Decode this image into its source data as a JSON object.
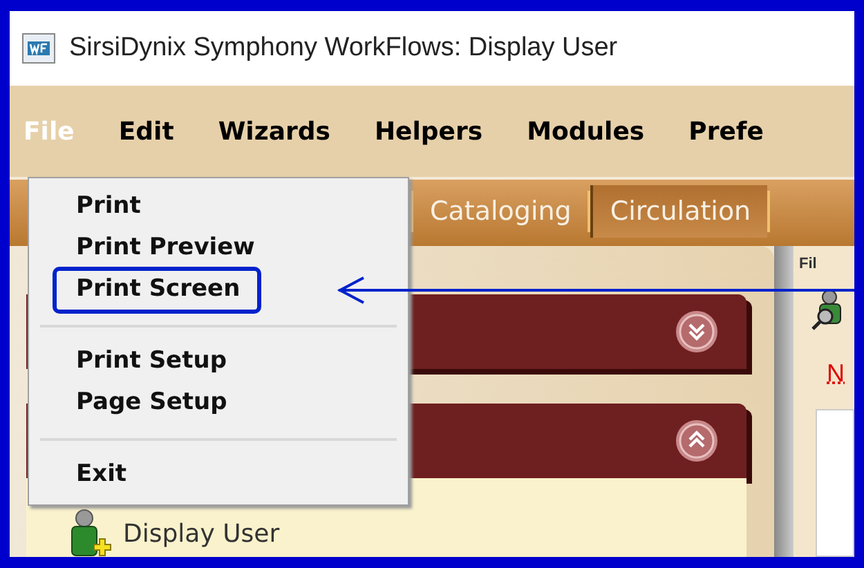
{
  "window": {
    "title": "SirsiDynix Symphony WorkFlows: Display User"
  },
  "menu_bar": [
    {
      "label": "File",
      "selected": true
    },
    {
      "label": "Edit",
      "selected": false
    },
    {
      "label": "Wizards",
      "selected": false
    },
    {
      "label": "Helpers",
      "selected": false
    },
    {
      "label": "Modules",
      "selected": false
    },
    {
      "label": "Prefe",
      "selected": false
    }
  ],
  "file_menu": [
    {
      "kind": "item",
      "label": "Print",
      "highlighted": false
    },
    {
      "kind": "item",
      "label": "Print Preview",
      "highlighted": false
    },
    {
      "kind": "item",
      "label": "Print Screen",
      "highlighted": true
    },
    {
      "kind": "separator"
    },
    {
      "kind": "item",
      "label": "Print Setup",
      "highlighted": false
    },
    {
      "kind": "item",
      "label": "Page Setup",
      "highlighted": false
    },
    {
      "kind": "separator"
    },
    {
      "kind": "item",
      "label": "Exit",
      "highlighted": false
    }
  ],
  "tabs": [
    {
      "label": "Cataloging",
      "selected": false
    },
    {
      "label": "Circulation",
      "selected": true
    }
  ],
  "panels": [
    {
      "expanded": false
    },
    {
      "expanded": true,
      "items": [
        {
          "label": "Display User"
        }
      ]
    }
  ],
  "side_panel": {
    "heading": "Fil",
    "link": "N"
  }
}
